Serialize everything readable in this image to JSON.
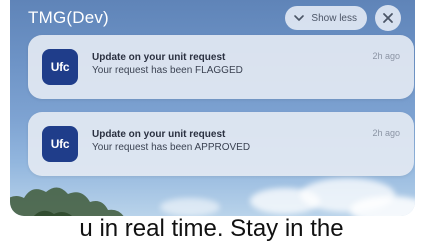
{
  "header": {
    "title": "TMG(Dev)",
    "show_less_label": "Show less"
  },
  "notifications": [
    {
      "app_icon_text": "Ufc",
      "title": "Update on your unit request",
      "body": "Your request has been FLAGGED",
      "time": "2h ago"
    },
    {
      "app_icon_text": "Ufc",
      "title": "Update on your unit request",
      "body": "Your request has been APPROVED",
      "time": "2h ago"
    }
  ],
  "caption": "u in real time. Stay in the"
}
